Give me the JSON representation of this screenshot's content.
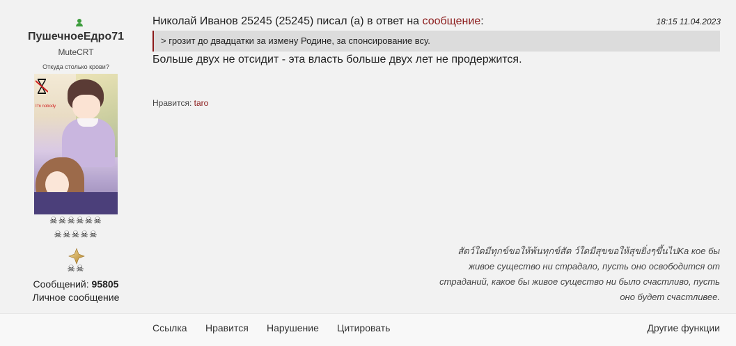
{
  "user": {
    "online_icon": "online-user-icon",
    "name": "ПушечноеЕдро71",
    "title": "MuteCRT",
    "status_text": "Откуда столько крови?",
    "avatar_overlay_text": "I'm nobody",
    "awards_row1": "☠☠☠☠☠☠",
    "awards_row2": "☠☠☠☠☠",
    "awards_row3": "☠☠",
    "rank_icon": "gold-star-icon",
    "post_count_label": "Сообщений:",
    "post_count": "95805",
    "pm_link": "Личное сообщение"
  },
  "post": {
    "header_prefix": "Николай Иванов 25245 (25245) писал (а) в ответ на",
    "reply_link": "сообщение",
    "header_suffix": ":",
    "time": "18:15 11.04.2023",
    "quote": "> грозит до двадцатки за измену Родине, за спонсирование всу.",
    "body": "Больше двух не отсидит - эта власть больше двух лет не продержится.",
    "likes_label": "Нравится:",
    "liker": "taro",
    "signature": "สัตว์ใดมีทุกข์ขอให้พ้นทุกข์สัต ว์ใดมีสุขขอให้สุขยิ่งๆขึ้นไปKa кое бы живое существо ни страдало, пусть оно освободится от страданий, какое бы живое существо ни было счастливо, пусть оно будет счастливее."
  },
  "actions": {
    "link": "Ссылка",
    "like": "Нравится",
    "report": "Нарушение",
    "quote": "Цитировать",
    "other": "Другие функции"
  },
  "colors": {
    "accent": "#8b1a1a",
    "background": "#f2f2f2",
    "quote_bg": "#dcdcdc",
    "online": "#3c9c3c"
  }
}
